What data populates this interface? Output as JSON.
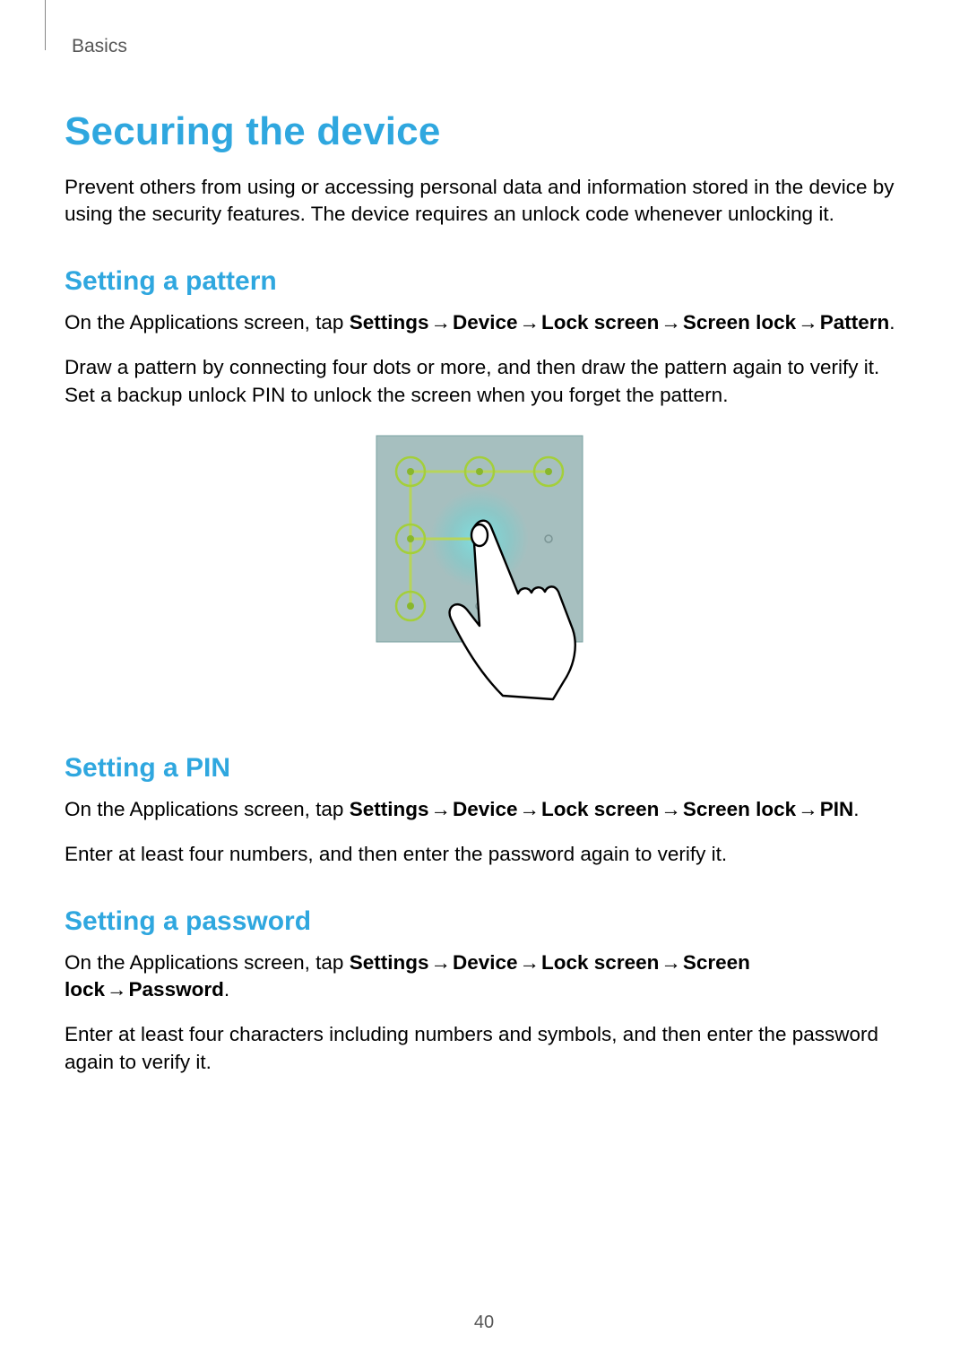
{
  "header": {
    "section": "Basics"
  },
  "title": "Securing the device",
  "intro": "Prevent others from using or accessing personal data and information stored in the device by using the security features. The device requires an unlock code whenever unlocking it.",
  "arrow": "→",
  "pattern": {
    "heading": "Setting a pattern",
    "p1_pre": "On the Applications screen, tap ",
    "nav1": "Settings",
    "nav2": "Device",
    "nav3": "Lock screen",
    "nav4": "Screen lock",
    "nav_end": "Pattern",
    "period": ".",
    "p2": "Draw a pattern by connecting four dots or more, and then draw the pattern again to verify it. Set a backup unlock PIN to unlock the screen when you forget the pattern."
  },
  "pin": {
    "heading": "Setting a PIN",
    "p1_pre": "On the Applications screen, tap ",
    "nav1": "Settings",
    "nav2": "Device",
    "nav3": "Lock screen",
    "nav4": "Screen lock",
    "nav_end": "PIN",
    "period": ".",
    "p2": "Enter at least four numbers, and then enter the password again to verify it."
  },
  "password": {
    "heading": "Setting a password",
    "p1_pre": "On the Applications screen, tap ",
    "nav1": "Settings",
    "nav2": "Device",
    "nav3": "Lock screen",
    "nav4": "Screen lock",
    "nav_end": "Password",
    "period": ".",
    "p2": "Enter at least four characters including numbers and symbols, and then enter the password again to verify it."
  },
  "page_number": "40"
}
